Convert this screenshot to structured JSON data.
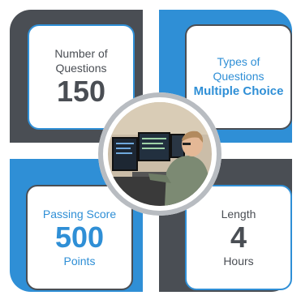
{
  "cards": {
    "questions": {
      "line1": "Number of",
      "line2": "Questions",
      "value": "150"
    },
    "types": {
      "line1": "Types of",
      "line2": "Questions",
      "value": "Multiple Choice"
    },
    "passing": {
      "line1": "Passing Score",
      "value": "500",
      "unit": "Points"
    },
    "length": {
      "line1": "Length",
      "value": "4",
      "unit": "Hours"
    }
  },
  "colors": {
    "dark": "#4a4e54",
    "blue": "#2f8fd6",
    "ring": "#b8bcc1"
  },
  "photo": {
    "subject": "airman at computer workstation",
    "icon": "person-at-computer-photo"
  }
}
